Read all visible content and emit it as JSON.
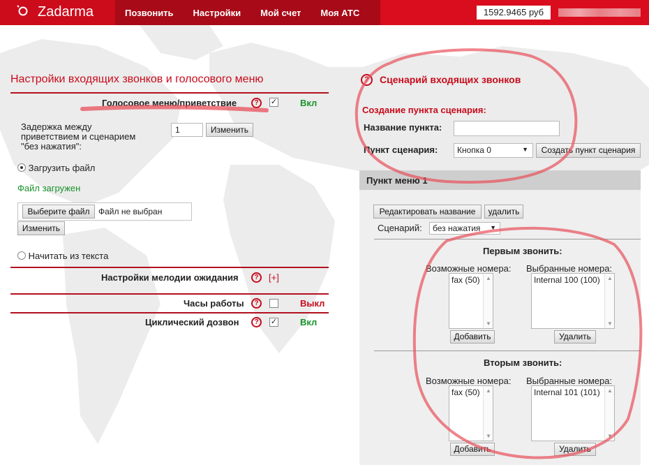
{
  "topbar": {
    "logo_text": "Zadarma",
    "nav": [
      "Позвонить",
      "Настройки",
      "Мой счет",
      "Моя АТС"
    ],
    "balance": "1592.9465 руб",
    "brand_color": "#d90d1d"
  },
  "left": {
    "title": "Настройки входящих звонков и голосового меню",
    "voice_menu": {
      "label": "Голосовое меню/приветствие",
      "checked": true,
      "state": "Вкл"
    },
    "delay": {
      "label_lines": [
        "Задержка между",
        "приветствием и сценарием",
        "\"без нажатия\":"
      ],
      "value": "1",
      "button": "Изменить"
    },
    "upload": {
      "radio_label": "Загрузить файл",
      "status": "Файл загружен",
      "choose_button": "Выберите файл",
      "no_file": "Файл не выбран",
      "change_button": "Изменить"
    },
    "read_text": {
      "radio_label": "Начитать из текста"
    },
    "hold_music": {
      "label": "Настройки мелодии ожидания",
      "expand": "[+]"
    },
    "working_hours": {
      "label": "Часы работы",
      "checked": false,
      "state": "Выкл"
    },
    "cyclic_dial": {
      "label": "Циклический дозвон",
      "checked": true,
      "state": "Вкл"
    }
  },
  "right": {
    "title": "Сценарий входящих звонков",
    "create_header": "Создание пункта сценария:",
    "name_label": "Название пункта:",
    "name_value": "",
    "scenario_label": "Пункт сценария:",
    "scenario_value": "Кнопка 0",
    "create_button": "Создать пункт сценария",
    "menu_item": {
      "title": "Пункт меню 1",
      "rename_button": "Редактировать название",
      "delete_button": "удалить",
      "scenario_label": "Сценарий:",
      "scenario_value": "без нажатия",
      "first": {
        "title": "Первым звонить:",
        "available_label": "Возможные номера:",
        "selected_label": "Выбранные номера:",
        "available": [
          "fax (50)"
        ],
        "selected": [
          "Internal 100 (100)"
        ],
        "add_button": "Добавить",
        "remove_button": "Удалить"
      },
      "second": {
        "title": "Вторым звонить:",
        "available_label": "Возможные номера:",
        "selected_label": "Выбранные номера:",
        "available": [
          "fax (50)"
        ],
        "selected": [
          "Internal 101 (101)"
        ],
        "add_button": "Добавить",
        "remove_button": "Удалить"
      }
    }
  },
  "colors": {
    "accent_red": "#c80b1b",
    "on_green": "#18932b",
    "annotation": "#e8505b"
  },
  "icons": [
    "help-icon",
    "checkbox-icon",
    "radio-icon",
    "dropdown-arrow-icon",
    "logo-icon"
  ]
}
